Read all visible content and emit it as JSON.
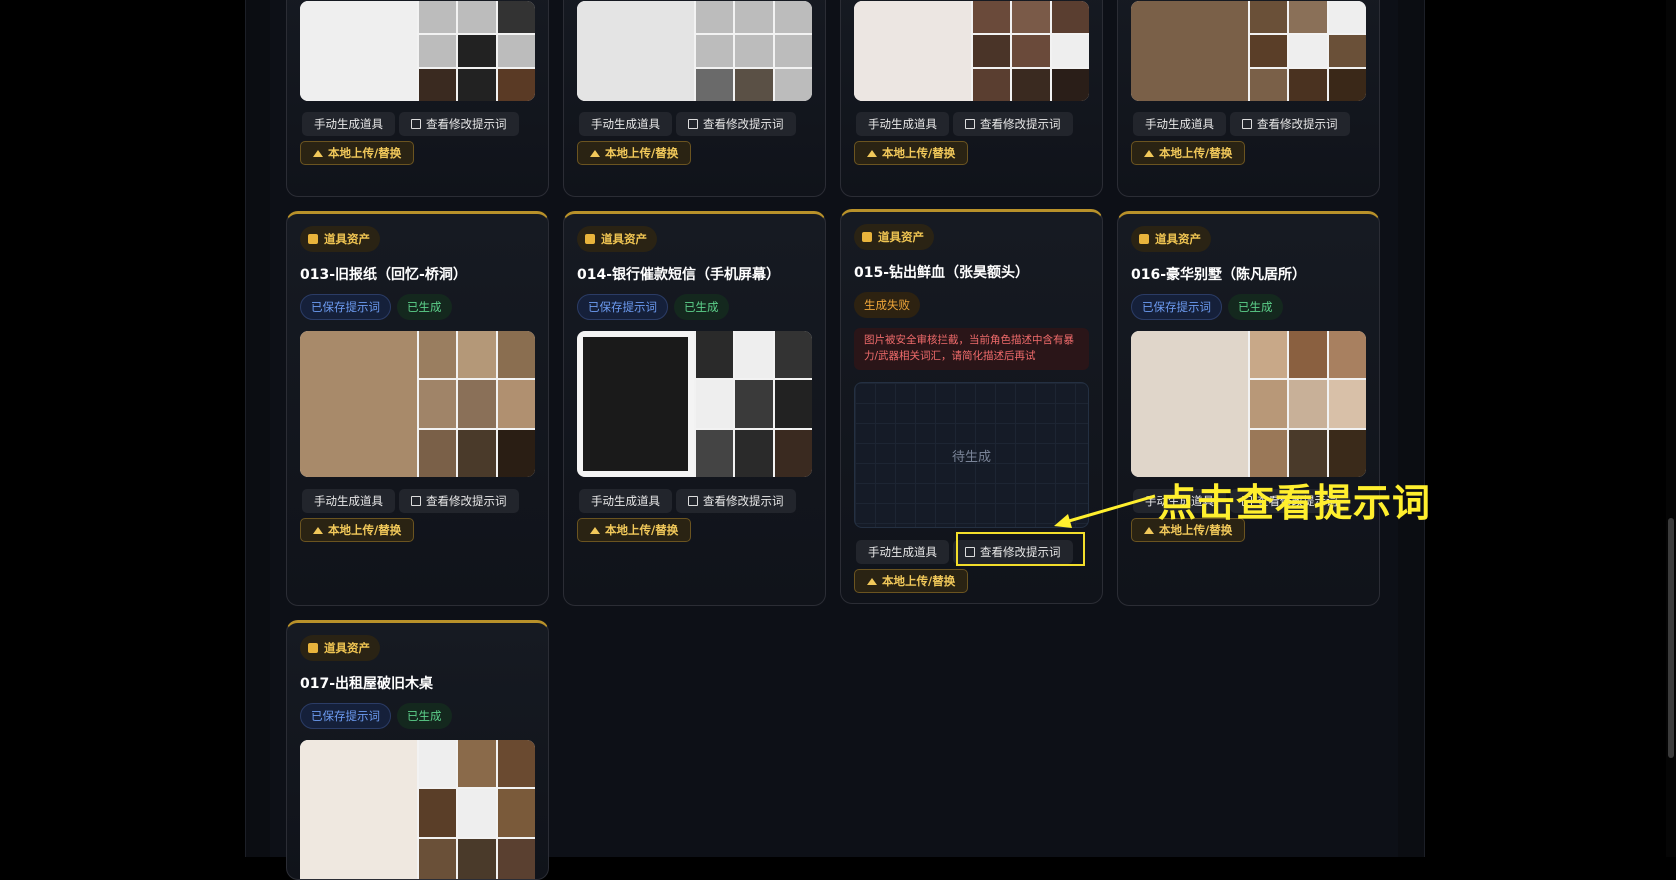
{
  "labels": {
    "asset_type": "道具资产",
    "manual_generate": "手动生成道具",
    "view_edit_prompt": "查看修改提示词",
    "local_upload": "本地上传/替换",
    "saved_prompt": "已保存提示词",
    "generated": "已生成",
    "generate_failed": "生成失败",
    "pending": "待生成"
  },
  "cards": [
    {
      "title": "013-旧报纸（回忆-桥洞）"
    },
    {
      "title": "014-银行催款短信（手机屏幕）"
    },
    {
      "title": "015-钻出鲜血（张昊额头）",
      "error": "图片被安全审核拦截，当前角色描述中含有暴力/武器相关词汇，请简化描述后再试"
    },
    {
      "title": "016-豪华别墅（陈凡居所）"
    },
    {
      "title": "017-出租屋破旧木桌"
    }
  ],
  "annotation": {
    "text": "点击查看提示词",
    "color": "#ffef2e"
  }
}
